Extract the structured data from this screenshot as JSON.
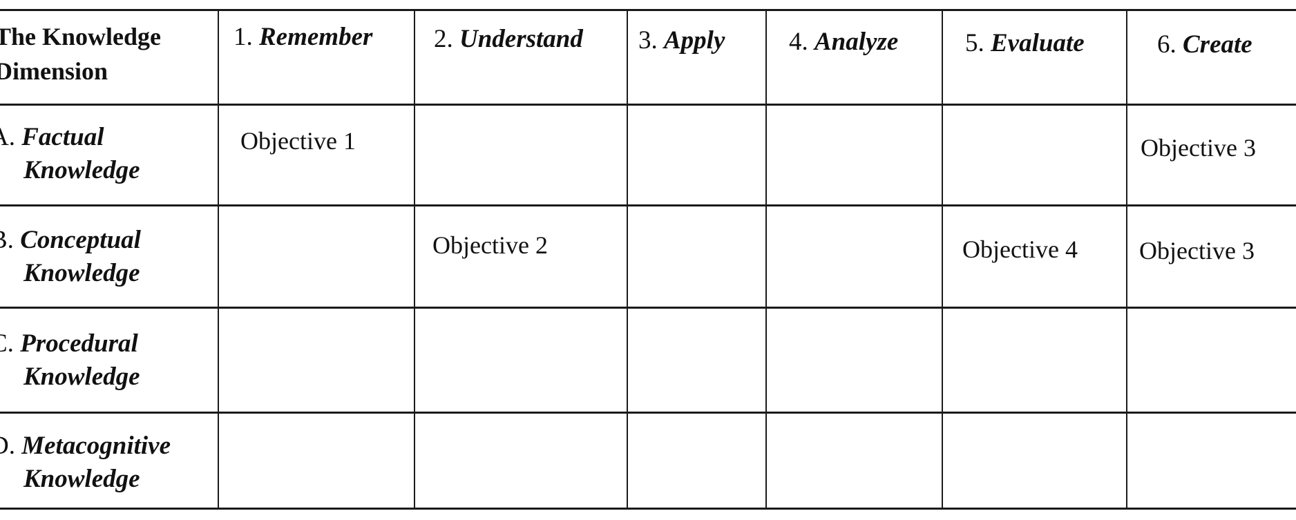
{
  "table": {
    "corner_label_lines": [
      "The Knowledge",
      "Dimension"
    ],
    "columns": [
      {
        "number": "1.",
        "name": "Remember"
      },
      {
        "number": "2.",
        "name": "Understand"
      },
      {
        "number": "3.",
        "name": "Apply"
      },
      {
        "number": "4.",
        "name": "Analyze"
      },
      {
        "number": "5.",
        "name": "Evaluate"
      },
      {
        "number": "6.",
        "name": "Create"
      }
    ],
    "rows": [
      {
        "letter": "A.",
        "name": "Factual",
        "second_line": "Knowledge",
        "cells": [
          "Objective 1",
          "",
          "",
          "",
          "",
          "Objective 3"
        ]
      },
      {
        "letter": "B.",
        "name": "Conceptual",
        "second_line": "Knowledge",
        "cells": [
          "",
          "Objective 2",
          "",
          "",
          "Objective 4",
          "Objective 3"
        ]
      },
      {
        "letter": "C.",
        "name": "Procedural",
        "second_line": "Knowledge",
        "cells": [
          "",
          "",
          "",
          "",
          "",
          ""
        ]
      },
      {
        "letter": "D.",
        "name": "Metacognitive",
        "second_line": "Knowledge",
        "cells": [
          "",
          "",
          "",
          "",
          "",
          ""
        ]
      }
    ]
  }
}
